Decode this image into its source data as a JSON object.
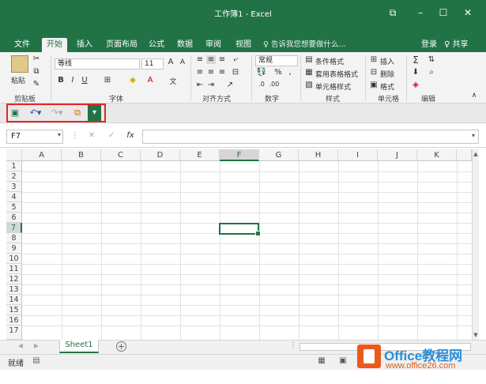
{
  "app": {
    "title": "工作簿1 - Excel",
    "controls": {
      "restore_icon": "⧉",
      "minimize": "–",
      "maximize": "☐",
      "close": "✕"
    }
  },
  "tabs": [
    "文件",
    "开始",
    "插入",
    "页面布局",
    "公式",
    "数据",
    "审阅",
    "视图"
  ],
  "active_tab": "开始",
  "tell_me": "♀ 告诉我您想要做什么...",
  "signin": "登录",
  "share": "♀ 共享",
  "ribbon": {
    "clipboard": {
      "paste": "粘贴",
      "label": "剪贴板"
    },
    "font": {
      "name": "等线",
      "size": "11",
      "label": "字体",
      "bold": "B",
      "italic": "I",
      "underline": "U"
    },
    "alignment": {
      "label": "对齐方式"
    },
    "number": {
      "format": "常规",
      "label": "数字"
    },
    "styles": {
      "conditional": "条件格式",
      "table": "套用表格格式",
      "cell": "单元格样式",
      "label": "样式"
    },
    "cells": {
      "insert": "插入",
      "delete": "删除",
      "format": "格式",
      "label": "单元格"
    },
    "editing": {
      "label": "编辑"
    }
  },
  "formula_bar": {
    "name_box": "F7",
    "value": ""
  },
  "columns": [
    "A",
    "B",
    "C",
    "D",
    "E",
    "F",
    "G",
    "H",
    "I",
    "J",
    "K"
  ],
  "rows": [
    "1",
    "2",
    "3",
    "4",
    "5",
    "6",
    "7",
    "8",
    "9",
    "10",
    "11",
    "12",
    "13",
    "14",
    "15",
    "16",
    "17"
  ],
  "selected": {
    "column": "F",
    "row": "7"
  },
  "sheet_tab": "Sheet1",
  "status": "就绪",
  "watermark": {
    "title": "Office教程网",
    "url": "www.office26.com"
  },
  "colors": {
    "accent": "#217346",
    "highlight": "#e3262b",
    "watermark_orange": "#ea5a1a",
    "watermark_blue": "#2b8fd7"
  }
}
